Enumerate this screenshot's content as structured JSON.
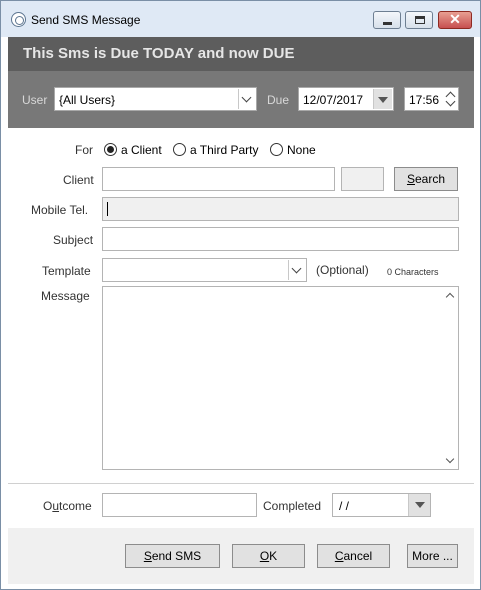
{
  "window": {
    "title": "Send SMS Message",
    "buttons": {
      "minimize": "minimize-icon",
      "maximize": "maximize-icon",
      "close": "close-icon"
    }
  },
  "banner": {
    "text": "This Sms is Due TODAY and now DUE",
    "background": "#5d5d5d"
  },
  "filter": {
    "user_label": "User",
    "user_value": "{All Users}",
    "due_label": "Due",
    "due_date": "12/07/2017",
    "due_time": "17:56",
    "background": "#787878"
  },
  "form": {
    "for_label": "For",
    "recipient_options": [
      {
        "label": "a Client",
        "checked": true
      },
      {
        "label": "a Third Party",
        "checked": false
      },
      {
        "label": "None",
        "checked": false
      }
    ],
    "client_label": "Client",
    "client_value": "",
    "search_button": "Search",
    "mobile_label": "Mobile Tel.",
    "mobile_value": "",
    "subject_label": "Subject",
    "subject_value": "",
    "template_label": "Template",
    "template_value": "",
    "template_hint": "(Optional)",
    "char_count": "0 Characters",
    "message_label": "Message",
    "message_value": "",
    "outcome_label": "Outcome",
    "outcome_value": "",
    "completed_label": "Completed",
    "completed_value": "  /  /"
  },
  "footer": {
    "send_sms": "Send SMS",
    "ok": "OK",
    "cancel": "Cancel",
    "more": "More ..."
  }
}
